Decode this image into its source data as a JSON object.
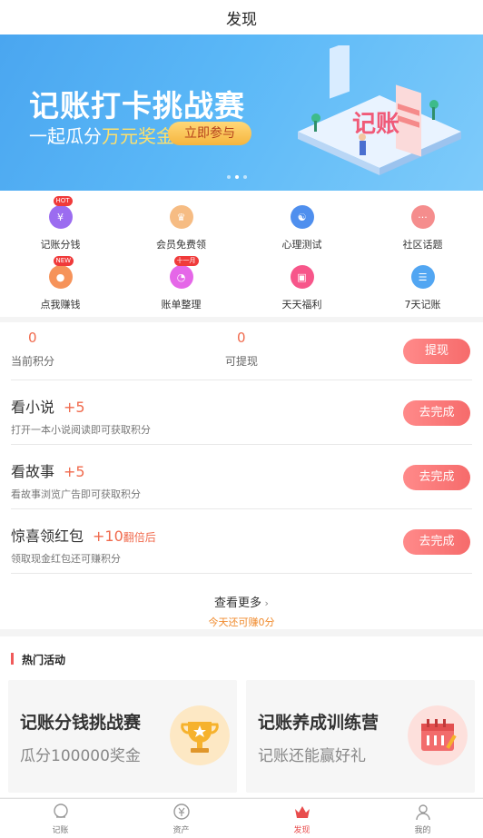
{
  "header": {
    "title": "发现"
  },
  "banner": {
    "title": "记账打卡挑战赛",
    "subtitle_prefix": "一起瓜分",
    "subtitle_highlight": "万元奖金",
    "cta_label": "立即参与",
    "illustration_text": "记账"
  },
  "quick_menu": {
    "items": [
      {
        "label": "记账分钱",
        "badge": "HOT",
        "icon": "coin-icon",
        "color": "#9b6cf0"
      },
      {
        "label": "会员免费领",
        "badge": "",
        "icon": "crown-icon",
        "color": "#f6bc83"
      },
      {
        "label": "心理测试",
        "badge": "",
        "icon": "psych-icon",
        "color": "#4f8fee"
      },
      {
        "label": "社区话题",
        "badge": "",
        "icon": "chat-icon",
        "color": "#f58d8d"
      },
      {
        "label": "点我赚钱",
        "badge": "NEW",
        "icon": "money-bag-icon",
        "color": "#f6935a"
      },
      {
        "label": "账单整理",
        "badge": "十一月",
        "icon": "bill-chart-icon",
        "color": "#e567e8"
      },
      {
        "label": "天天福利",
        "badge": "",
        "icon": "gift-icon",
        "color": "#f7568a"
      },
      {
        "label": "7天记账",
        "badge": "",
        "icon": "notebook-icon",
        "color": "#52a6f2"
      }
    ]
  },
  "points": {
    "current_value": "0",
    "current_label": "当前积分",
    "withdrawable_value": "0",
    "withdrawable_label": "可提现",
    "withdraw_button": "提现"
  },
  "tasks": [
    {
      "title": "看小说",
      "bonus": "+5",
      "bonus_suffix": "",
      "desc": "打开一本小说阅读即可获取积分",
      "button": "去完成"
    },
    {
      "title": "看故事",
      "bonus": "+5",
      "bonus_suffix": "",
      "desc": "看故事浏览广告即可获取积分",
      "button": "去完成"
    },
    {
      "title": "惊喜领红包",
      "bonus": "+10",
      "bonus_suffix": "翻倍后",
      "desc": "领取现金红包还可赚积分",
      "button": "去完成"
    }
  ],
  "more": {
    "label": "查看更多",
    "earn_text": "今天还可赚0分"
  },
  "hot": {
    "title": "热门活动",
    "cards": [
      {
        "title": "记账分钱挑战赛",
        "subtitle": "瓜分100000奖金",
        "icon": "trophy-icon"
      },
      {
        "title": "记账养成训练营",
        "subtitle": "记账还能赢好礼",
        "icon": "calendar-icon"
      }
    ]
  },
  "tabbar": {
    "tabs": [
      {
        "label": "记账",
        "icon": "ledger-icon",
        "active": false
      },
      {
        "label": "资产",
        "icon": "yen-icon",
        "active": false
      },
      {
        "label": "发现",
        "icon": "discover-crown-icon",
        "active": true
      },
      {
        "label": "我的",
        "icon": "profile-icon",
        "active": false
      }
    ]
  },
  "colors": {
    "accent": "#f06a4d",
    "button": "#f66b6b",
    "banner": "#5bb8f7",
    "earn": "#f08a2c"
  }
}
